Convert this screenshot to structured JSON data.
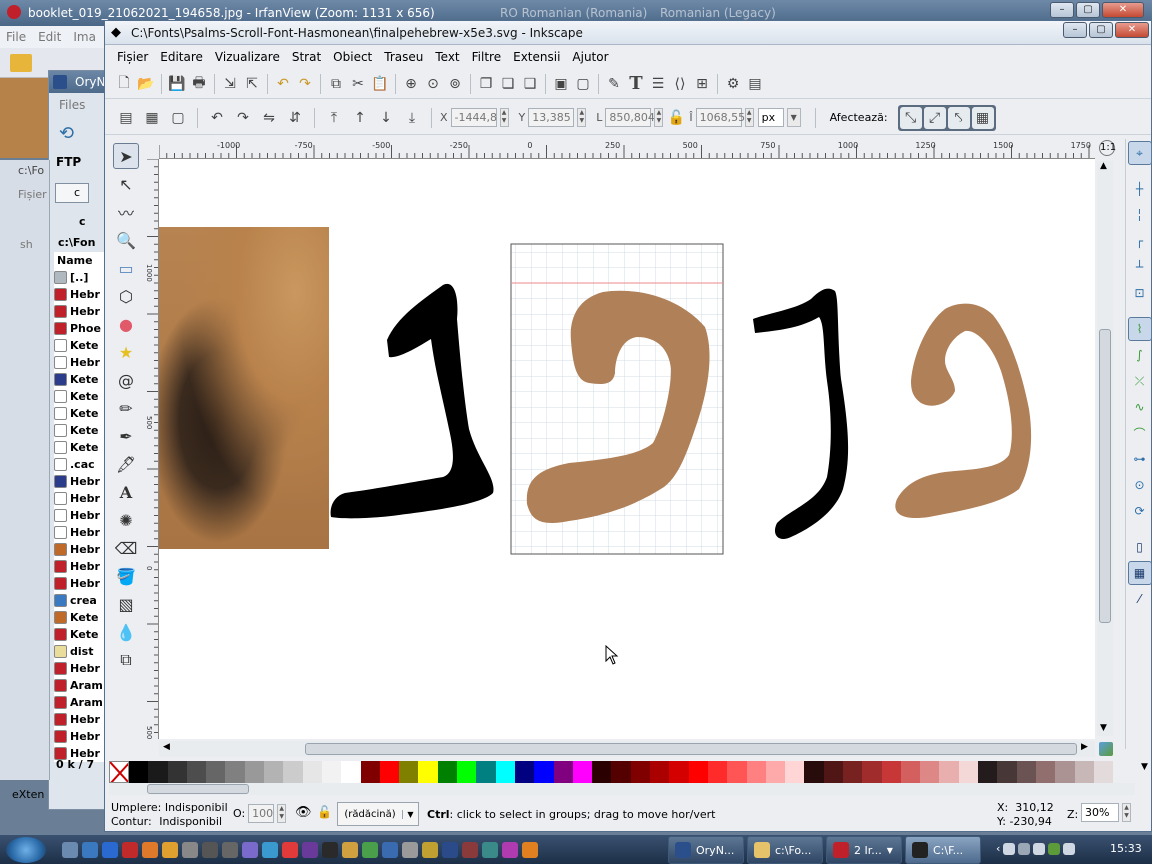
{
  "desktop": {
    "irfan_title": "booklet_019_21062021_194658.jpg - IrfanView (Zoom: 1131 x 656)",
    "keyboard_layouts": [
      "RO Romanian (Romania)",
      "Romanian (Legacy)"
    ],
    "irfan_menu": [
      "File",
      "Edit",
      "Ima"
    ],
    "oryn_title": "OryN",
    "oryn_menu": [
      "Files"
    ],
    "ftp_label": "FTP",
    "drive_c": "c",
    "drive_c2": "c",
    "path_label": "c:\\Fo",
    "fisier_label": "Fișier",
    "sh_label": "sh",
    "tree_root": "c:\\Fon",
    "name_header": "Name",
    "files": [
      "[..]",
      "Hebr",
      "Hebr",
      "Phoe",
      "Kete",
      "Hebr",
      "Kete",
      "Kete",
      "Kete",
      "Kete",
      "Kete",
      ".cac",
      "Hebr",
      "Hebr",
      "Hebr",
      "Hebr",
      "Hebr",
      "Hebr",
      "Hebr",
      "crea",
      "Kete",
      "Kete",
      "dist",
      "Hebr",
      "Aram",
      "Aram",
      "Hebr",
      "Hebr",
      "Hebr"
    ],
    "file_icon_colors": [
      "#b0b8c0",
      "#c0202a",
      "#c0202a",
      "#c0202a",
      "#ffffff",
      "#ffffff",
      "#2a3c8a",
      "#ffffff",
      "#ffffff",
      "#ffffff",
      "#ffffff",
      "#ffffff",
      "#2a3c8a",
      "#ffffff",
      "#ffffff",
      "#ffffff",
      "#c06a2a",
      "#c0202a",
      "#c0202a",
      "#3a7ac0",
      "#c06a2a",
      "#c0202a",
      "#eadc9a",
      "#c0202a",
      "#c0202a",
      "#c0202a",
      "#c0202a",
      "#c0202a",
      "#c0202a"
    ],
    "status_size": "0 k / 7",
    "extern_label": "eXten"
  },
  "inkscape": {
    "title": "C:\\Fonts\\Psalms-Scroll-Font-Hasmonean\\finalpehebrew-x5e3.svg - Inkscape",
    "menu": [
      "Fișier",
      "Editare",
      "Vizualizare",
      "Strat",
      "Obiect",
      "Traseu",
      "Text",
      "Filtre",
      "Extensii",
      "Ajutor"
    ],
    "toolbar_icons": [
      "new-icon",
      "open-icon",
      "save-icon",
      "print-icon",
      "import-icon",
      "export-icon",
      "undo-icon",
      "redo-icon",
      "copy-icon",
      "cut-icon",
      "paste-icon",
      "zoom-selection-icon",
      "zoom-drawing-icon",
      "zoom-page-icon",
      "duplicate-icon",
      "clone-icon",
      "unlink-clone-icon",
      "group-icon",
      "ungroup-icon",
      "fill-stroke-icon",
      "text-font-icon",
      "layers-icon",
      "xml-editor-icon",
      "align-icon",
      "preferences-icon",
      "document-properties-icon"
    ],
    "select_toolbar": {
      "x_label": "X",
      "x_value": "-1444,8",
      "y_label": "Y",
      "y_value": "13,385",
      "w_label": "L",
      "w_value": "850,804",
      "h_label": "Î",
      "h_value": "1068,55",
      "unit": "px",
      "affect_label": "Afectează:"
    },
    "ruler_h_labels": [
      "-1000",
      "-750",
      "-500",
      "-250",
      "0",
      "250",
      "500",
      "750",
      "1000",
      "1250",
      "1500",
      "1750"
    ],
    "ruler_v_labels": [
      "1000",
      "500",
      "0",
      "500"
    ],
    "tools": [
      "selector-icon",
      "node-icon",
      "tweak-icon",
      "zoom-icon",
      "rectangle-icon",
      "3dbox-icon",
      "ellipse-icon",
      "star-icon",
      "spiral-icon",
      "pencil-icon",
      "pen-icon",
      "calligraphy-icon",
      "text-icon",
      "spray-icon",
      "eraser-icon",
      "paint-bucket-icon",
      "gradient-icon",
      "dropper-icon",
      "connector-icon"
    ],
    "snap_tools": [
      "snap-toggle-icon",
      "snap-bbox-icon",
      "snap-bbox-edge-icon",
      "snap-bbox-corner-icon",
      "snap-bbox-midpoint-icon",
      "snap-bbox-center-icon",
      "snap-nodes-icon",
      "snap-path-icon",
      "snap-intersection-icon",
      "snap-cusp-icon",
      "snap-smooth-icon",
      "snap-midpoint-icon",
      "snap-center-icon",
      "snap-rotation-icon",
      "snap-page-icon",
      "snap-grid-icon",
      "snap-guide-icon"
    ],
    "palette": [
      "#000000",
      "#1a1a1a",
      "#333333",
      "#4d4d4d",
      "#666666",
      "#808080",
      "#999999",
      "#b3b3b3",
      "#cccccc",
      "#e6e6e6",
      "#f2f2f2",
      "#ffffff",
      "#800000",
      "#ff0000",
      "#808000",
      "#ffff00",
      "#008000",
      "#00ff00",
      "#008080",
      "#00ffff",
      "#000080",
      "#0000ff",
      "#800080",
      "#ff00ff",
      "#2b0000",
      "#550000",
      "#800000",
      "#aa0000",
      "#d40000",
      "#ff0000",
      "#ff2a2a",
      "#ff5555",
      "#ff8080",
      "#ffaaaa",
      "#ffd5d5",
      "#280b0b",
      "#501616",
      "#782121",
      "#a02c2c",
      "#c83737",
      "#d35f5f",
      "#de8787",
      "#e9afaf",
      "#f4d7d7",
      "#241c1c",
      "#483737",
      "#6c5353",
      "#916f6f",
      "#ac9393",
      "#c8b7b7",
      "#e3dbdb"
    ],
    "status": {
      "fill_label": "Umplere:",
      "fill_value": "Indisponibil",
      "stroke_label": "Contur:",
      "stroke_value": "Indisponibil",
      "opacity_label": "O:",
      "opacity_value": "100",
      "layer_value": "(rădăcină)",
      "message_bold": "Ctrl",
      "message": ": click to select in groups; drag to move hor/vert",
      "x_readout": "X:  310,12",
      "y_readout": "Y: -230,94",
      "zoom_label": "Z:",
      "zoom_value": "30%"
    },
    "colors": {
      "glyph_black": "#000000",
      "glyph_tan": "#b08058",
      "page_border": "#555555",
      "grid": "#d0dce6",
      "guide": "#ee8888"
    }
  },
  "taskbar": {
    "buttons": [
      "OryN...",
      "c:\\Fo...",
      "2 Ir...",
      "C:\\F..."
    ],
    "clock": "15:33"
  }
}
